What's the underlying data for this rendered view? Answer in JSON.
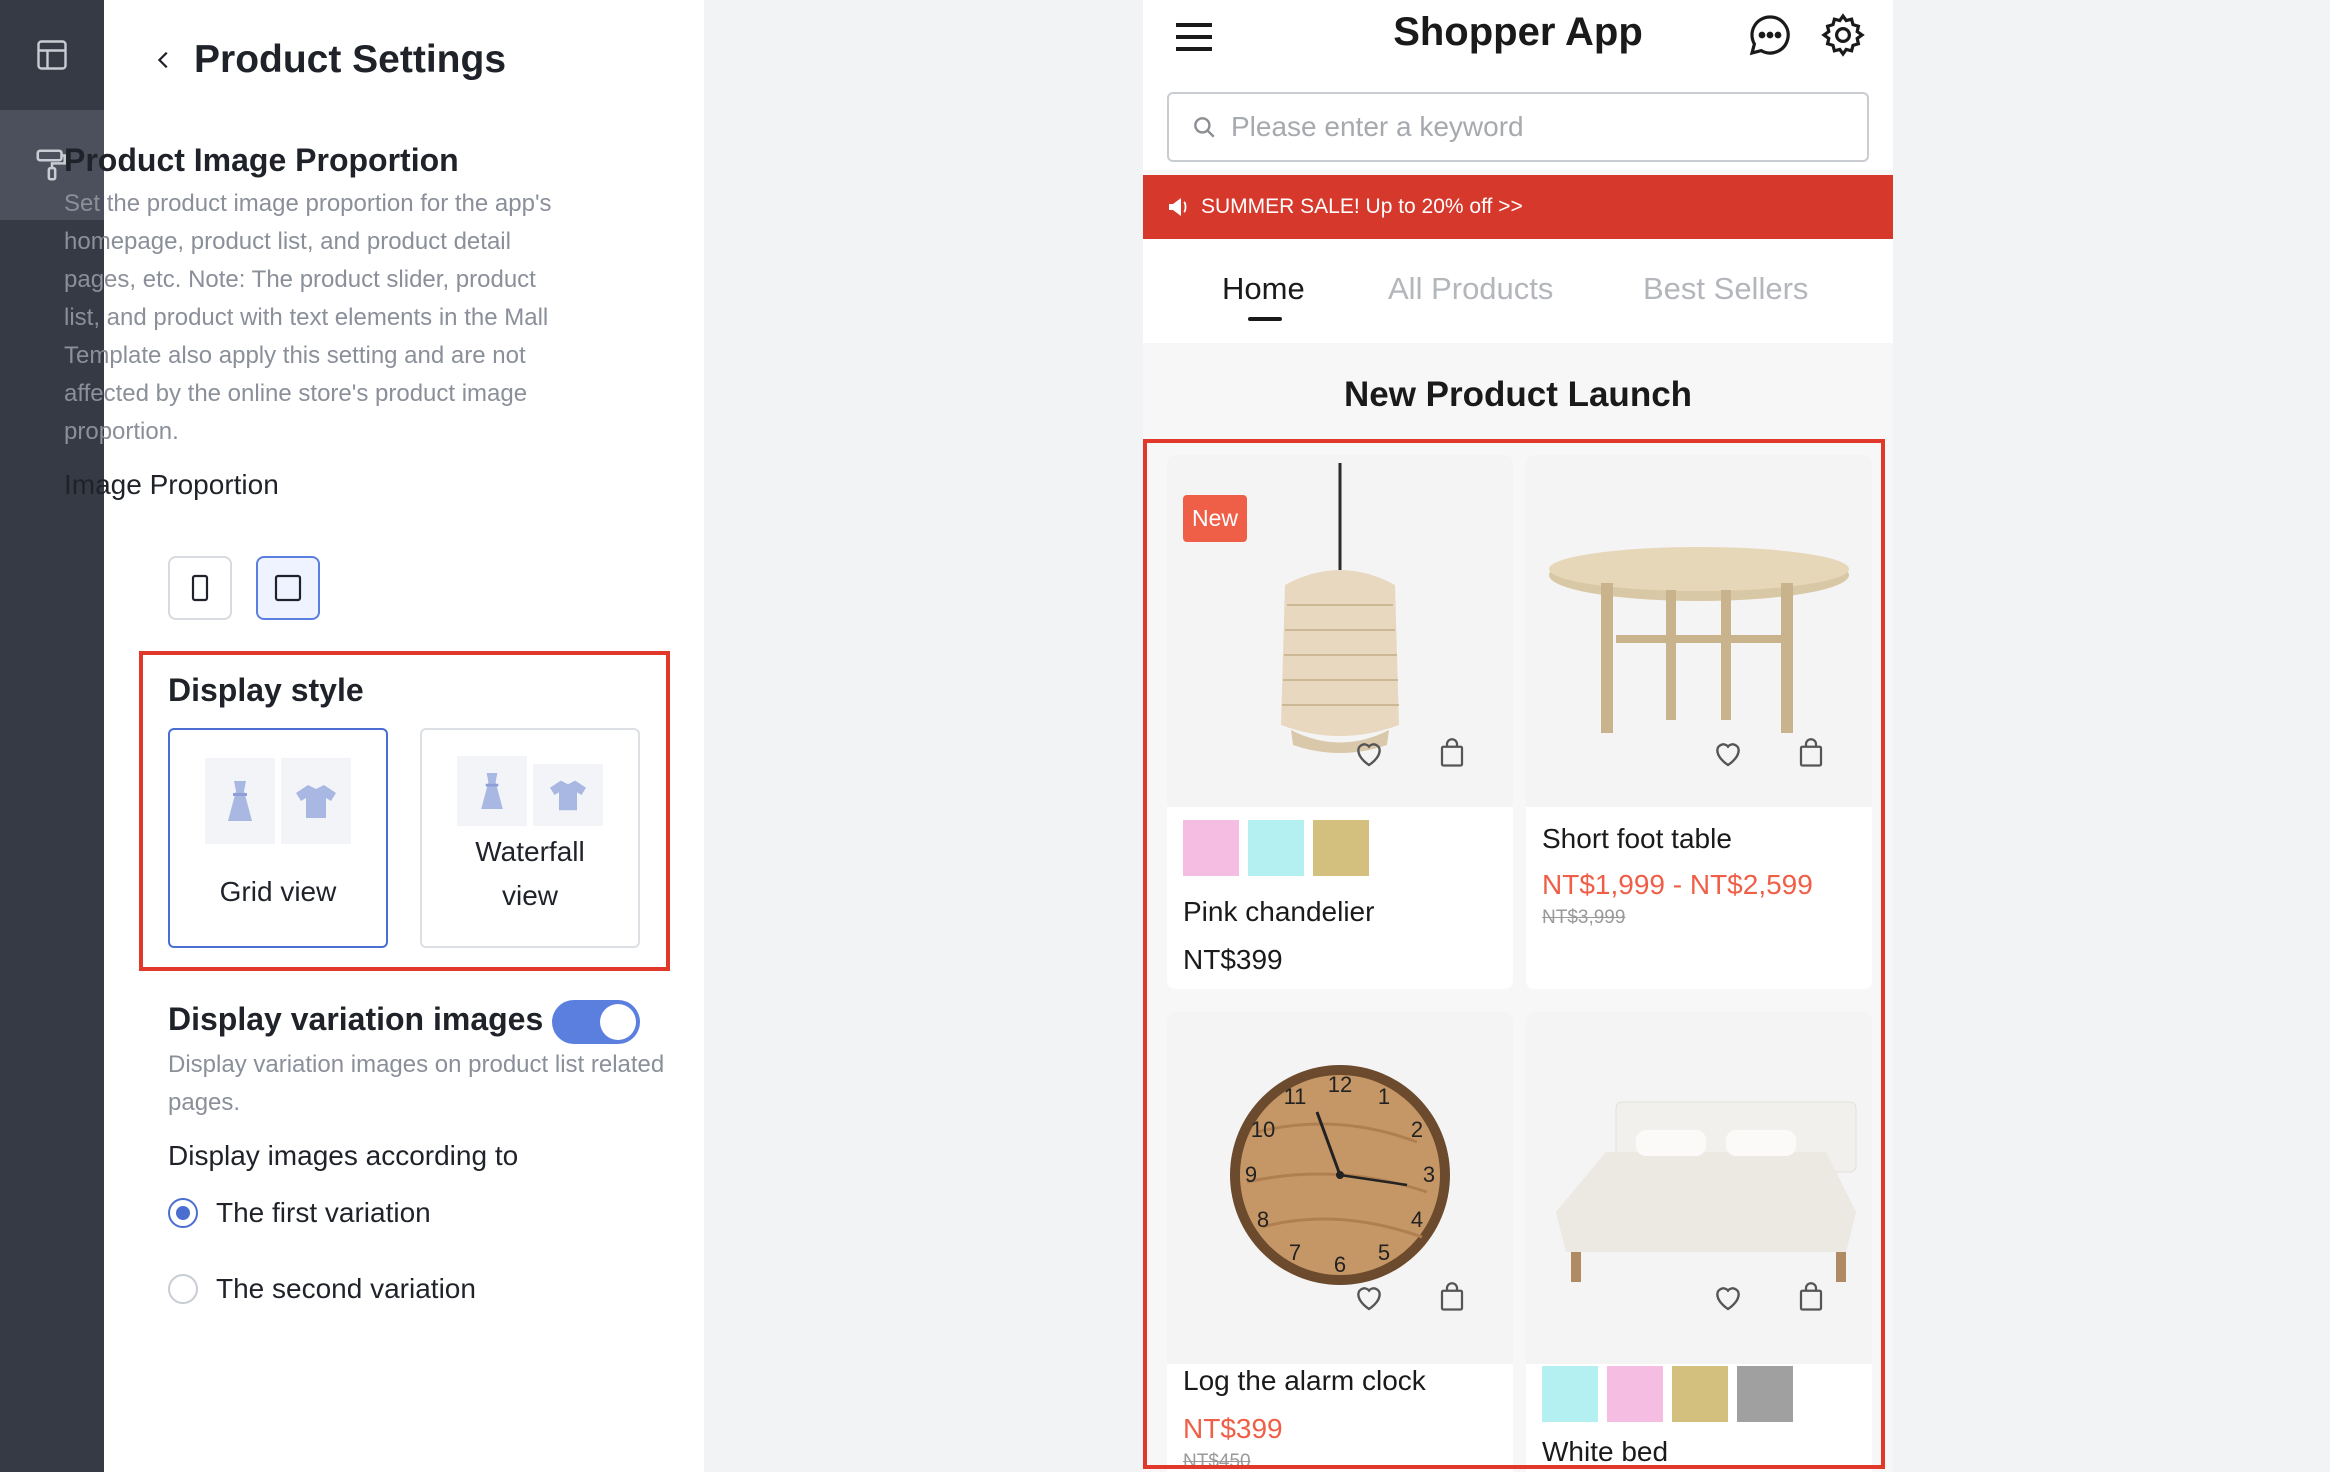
{
  "sidebar_rail": {
    "items": [
      {
        "icon": "layout-icon",
        "active": false
      },
      {
        "icon": "paint-roller-icon",
        "active": true
      }
    ]
  },
  "panel": {
    "title": "Product Settings",
    "image_proportion": {
      "title": "Product Image Proportion",
      "description": "Set the product image proportion for the app's homepage, product list, and product detail pages, etc. Note: The product slider, product list, and product with text elements in the Mall Template also apply this setting and are not affected by the online store's product image proportion.",
      "label": "Image Proportion",
      "options": [
        "portrait",
        "square"
      ],
      "selected": "square"
    },
    "display_style": {
      "title": "Display style",
      "options": [
        {
          "label": "Grid view",
          "selected": true
        },
        {
          "label_line1": "Waterfall",
          "label_line2": "view",
          "selected": false
        }
      ]
    },
    "variation_images": {
      "title": "Display variation images",
      "enabled": true,
      "description": "Display variation images on product list related pages.",
      "according_label": "Display images according to",
      "options": [
        {
          "label": "The first variation",
          "checked": true
        },
        {
          "label": "The second variation",
          "checked": false
        }
      ]
    }
  },
  "preview": {
    "app_title": "Shopper App",
    "search_placeholder": "Please enter a keyword",
    "banner_text": "SUMMER SALE! Up to 20% off >>",
    "tabs": [
      {
        "label": "Home",
        "active": true
      },
      {
        "label": "All Products",
        "active": false
      },
      {
        "label": "Best Sellers",
        "active": false
      }
    ],
    "section_title": "New Product Launch",
    "products": [
      {
        "badge": "New",
        "name": "Pink chandelier",
        "price": "NT$399",
        "swatches": [
          "#f4bde1",
          "#b4f0f2",
          "#d3c07f"
        ]
      },
      {
        "name": "Short foot table",
        "price": "NT$1,999 - NT$2,599",
        "original_price": "NT$3,999"
      },
      {
        "name": "Log the alarm clock",
        "price": "NT$399",
        "original_price": "NT$450"
      },
      {
        "name": "White bed",
        "swatches": [
          "#b4f0f2",
          "#f4bde1",
          "#d3c07f",
          "#a0a0a0"
        ]
      }
    ]
  },
  "colors": {
    "accent": "#5b7fdf",
    "highlight_border": "#e0392b",
    "banner": "#d6382c",
    "sale_price": "#ef5f47"
  }
}
